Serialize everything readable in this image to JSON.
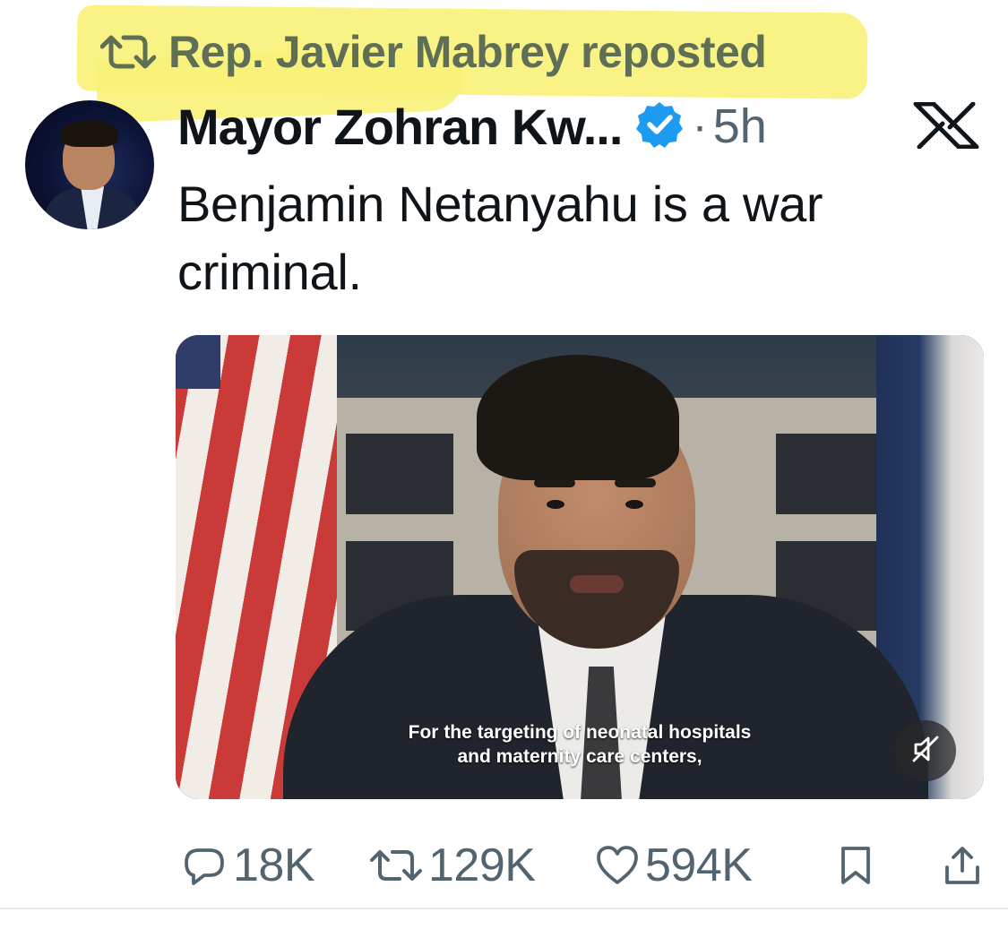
{
  "repost": {
    "text": "Rep. Javier Mabrey reposted",
    "icon": "repost-icon",
    "highlight_color": "#f7f27a"
  },
  "author": {
    "display_name": "Mayor Zohran Kw...",
    "verified": true,
    "separator": "·",
    "time": "5h"
  },
  "platform_logo": "x-logo",
  "tweet": {
    "line1": "Benjamin Netanyahu is a war",
    "line2": "criminal."
  },
  "video": {
    "caption_line1": "For the targeting of neonatal hospitals",
    "caption_line2": "and maternity care centers,",
    "muted": true
  },
  "actions": {
    "replies": "18K",
    "reposts": "129K",
    "likes": "594K",
    "bookmark_icon": "bookmark-icon",
    "share_icon": "share-icon"
  },
  "colors": {
    "verified_blue": "#1d9bf0",
    "muted_text": "#536471",
    "repost_text": "#5e6f56"
  }
}
